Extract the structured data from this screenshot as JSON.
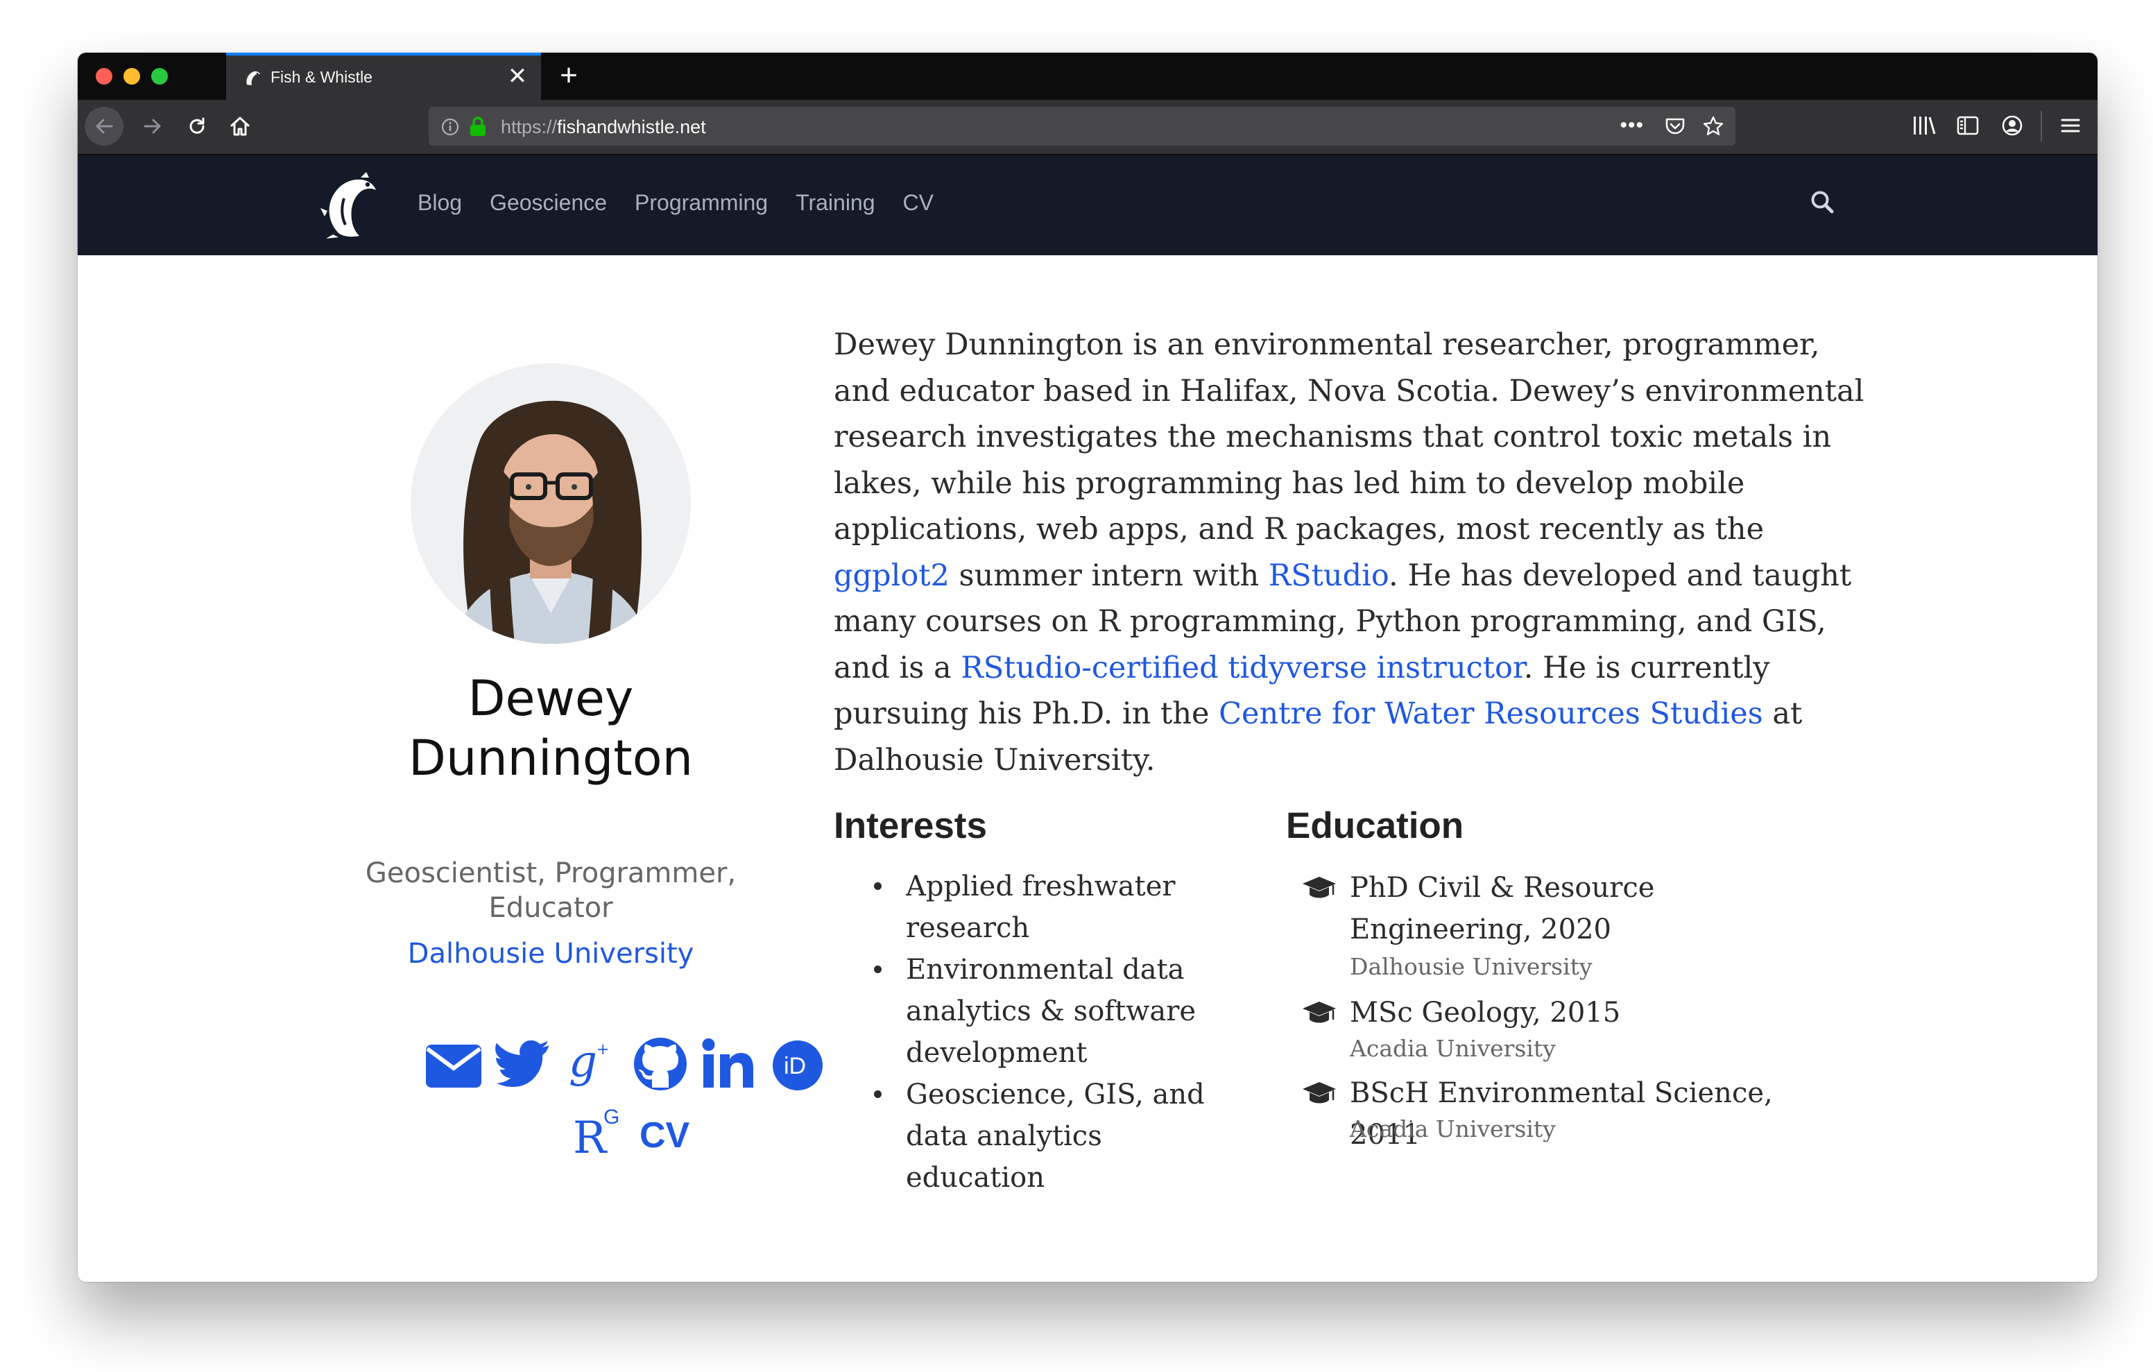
{
  "browser": {
    "tab_title": "Fish & Whistle",
    "tab_close": "✕",
    "new_tab": "+",
    "url_protocol": "https://",
    "url_host": "fishandwhistle.net",
    "url_more": "•••"
  },
  "site": {
    "nav_items": [
      "Blog",
      "Geoscience",
      "Programming",
      "Training",
      "CV"
    ],
    "icons": {
      "logo": "fish-whistle-logo-icon",
      "search": "search-icon"
    }
  },
  "profile": {
    "name": "Dewey Dunnington",
    "role": "Geoscientist, Programmer, Educator",
    "organization": "Dalhousie University",
    "socials": [
      "email-icon",
      "twitter-icon",
      "google-scholar-icon",
      "github-icon",
      "linkedin-icon",
      "orcid-icon",
      "researchgate-icon",
      "cv-icon"
    ],
    "cv_label": "CV",
    "researchgate_label": "R",
    "researchgate_superscript": "G",
    "orcid_label": "iD"
  },
  "bio": {
    "part1": "Dewey Dunnington is an environmental researcher, programmer, and educator based in Halifax, Nova Scotia. Dewey’s environmental research investigates the mechanisms that control toxic metals in lakes, while his programming has led him to develop mobile applications, web apps, and R packages, most recently as the ",
    "link1": "ggplot2",
    "part2": " summer intern with ",
    "link2": "RStudio",
    "part3": ". He has developed and taught many courses on R programming, Python programming, and GIS, and is a ",
    "link3": "RStudio-certified tidyverse instructor",
    "part4": ". He is currently pursuing his Ph.D. in the ",
    "link4": "Centre for Water Resources Studies",
    "part5": " at Dalhousie University."
  },
  "interests": {
    "title": "Interests",
    "items": [
      "Applied freshwater research",
      "Environmental data analytics & software development",
      "Geoscience, GIS, and data analytics education"
    ]
  },
  "education": {
    "title": "Education",
    "items": [
      {
        "degree": "PhD Civil & Resource Engineering, 2020",
        "school": "Dalhousie University"
      },
      {
        "degree": "MSc Geology, 2015",
        "school": "Acadia University"
      },
      {
        "degree": "BScH Environmental Science, 2011",
        "school": "Acadia University"
      }
    ]
  },
  "colors": {
    "link": "#1f58e0",
    "nav_bg": "#151a28",
    "browser_chrome": "#323234"
  }
}
